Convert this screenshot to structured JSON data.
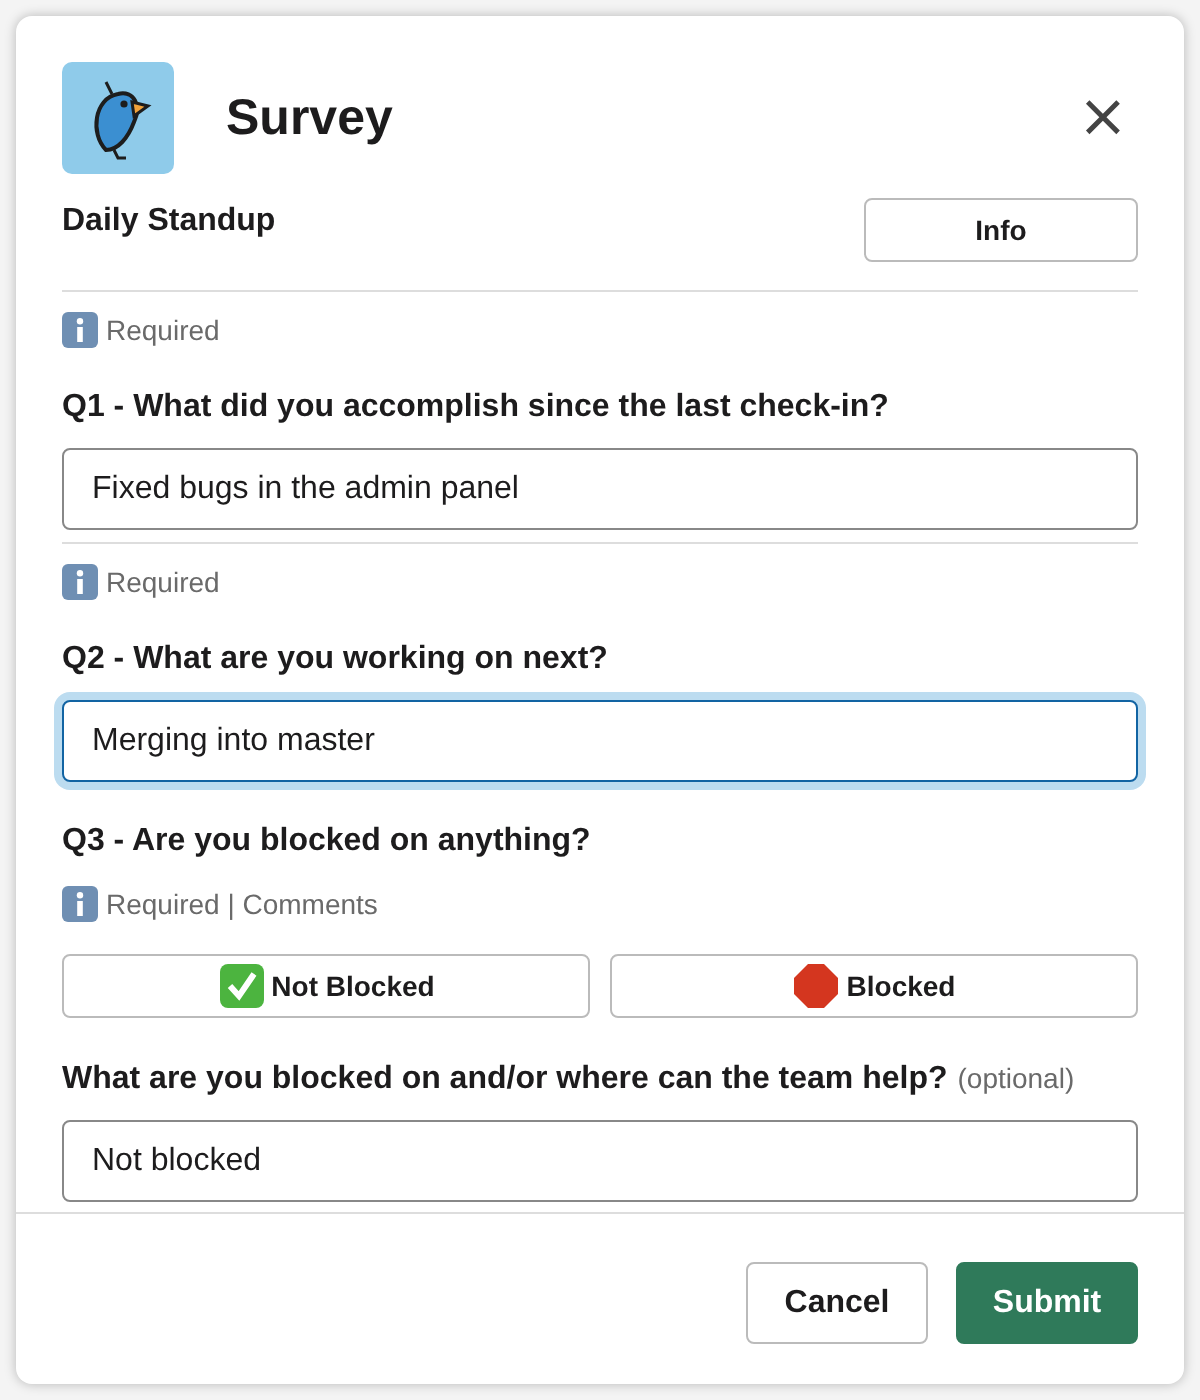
{
  "window": {
    "title": "Survey",
    "close": "×"
  },
  "header": {
    "title": "Daily Standup",
    "button": "Info"
  },
  "blocks": [
    {
      "kind": "divider"
    },
    {
      "kind": "hint",
      "text": "Required"
    },
    {
      "kind": "question",
      "text": "Q1 - What did you accomplish since the last check-in?"
    },
    {
      "kind": "input",
      "value": "Fixed bugs in the admin panel",
      "focused": false
    },
    {
      "kind": "divider"
    },
    {
      "kind": "hint",
      "text": "Required"
    },
    {
      "kind": "question",
      "text": "Q2 - What are you working on next?"
    },
    {
      "kind": "input",
      "value": "Merging into master",
      "focused": true
    },
    {
      "kind": "question",
      "text": "Q3 - Are you blocked on anything?"
    },
    {
      "kind": "hint",
      "text": "Required | Comments"
    },
    {
      "kind": "choices",
      "options": [
        {
          "label": "Not Blocked",
          "kind": "check"
        },
        {
          "label": "Blocked",
          "kind": "stop"
        }
      ]
    },
    {
      "kind": "question",
      "text": "What are you blocked on and/or where can the team help?",
      "note": "(optional)"
    },
    {
      "kind": "input",
      "value": "Not blocked",
      "focused": false
    }
  ],
  "footer": {
    "buttons": [
      {
        "label": "Cancel",
        "kind": "secondary"
      },
      {
        "label": "Submit",
        "kind": "primary"
      }
    ]
  }
}
